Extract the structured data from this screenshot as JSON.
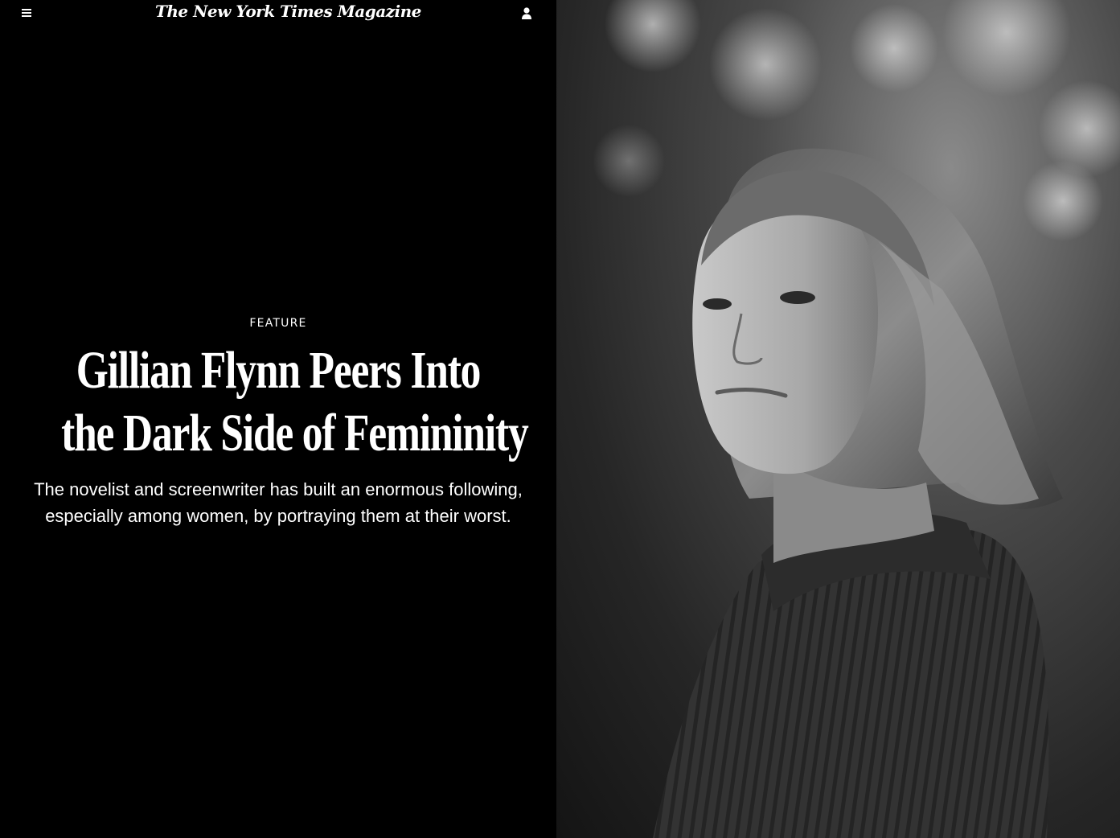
{
  "header": {
    "masthead": "The New York Times Magazine",
    "menu_icon": "hamburger-menu-icon",
    "account_icon": "user-account-icon"
  },
  "article": {
    "kicker": "FEATURE",
    "headline_line1": "Gillian Flynn Peers Into",
    "headline_line2": "the Dark Side of Femininity",
    "dek": "The novelist and screenwriter has built an enormous following, especially among women, by portraying them at their worst."
  },
  "photo": {
    "description_icon": "portrait-photo"
  },
  "colors": {
    "background": "#000000",
    "text": "#ffffff"
  }
}
